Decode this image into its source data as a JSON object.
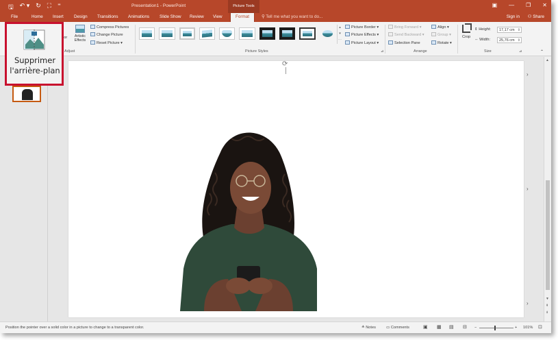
{
  "titlebar": {
    "title": "Presentation1 - PowerPoint",
    "contextual_group": "Picture Tools",
    "qat": {
      "save": "🖫",
      "undo": "↶ ▾",
      "redo": "↻",
      "present": "⛶",
      "more": "⁼"
    },
    "win_buttons": {
      "options": "▣",
      "minimize": "—",
      "restore": "❐",
      "close": "✕"
    }
  },
  "tabs": {
    "file": "File",
    "home": "Home",
    "insert": "Insert",
    "design": "Design",
    "transitions": "Transitions",
    "animations": "Animations",
    "slideshow": "Slide Show",
    "review": "Review",
    "view": "View",
    "format": "Format",
    "tell_me": "Tell me what you want to do...",
    "sign_in": "Sign in",
    "share": "Share"
  },
  "ribbon": {
    "adjust": {
      "color_label": "lor",
      "artistic_label1": "Artistic",
      "artistic_label2": "Effects",
      "compress": "Compress Pictures",
      "change": "Change Picture",
      "reset": "Reset Picture",
      "group_label": "Adjust"
    },
    "picture_styles": {
      "group_label": "Picture Styles",
      "border": "Picture Border",
      "effects": "Picture Effects",
      "layout": "Picture Layout"
    },
    "arrange": {
      "group_label": "Arrange",
      "bring_forward": "Bring Forward",
      "send_backward": "Send Backward",
      "selection_pane": "Selection Pane",
      "align": "Align",
      "group": "Group",
      "rotate": "Rotate"
    },
    "size": {
      "group_label": "Size",
      "crop": "Crop",
      "height_label": "Height:",
      "height_value": "17,17 cm",
      "width_label": "Width:",
      "width_value": "25,76 cm"
    }
  },
  "callout": {
    "label": "Supprimer l'arrière-plan",
    "border_color": "#c8102e"
  },
  "statusbar": {
    "message": "Position the pointer over a solid color in a picture to change to a transparent color.",
    "notes": "Notes",
    "comments": "Comments",
    "zoom": "101%"
  },
  "colors": {
    "accent": "#b7472a",
    "tab_text_active": "#b7472a"
  }
}
